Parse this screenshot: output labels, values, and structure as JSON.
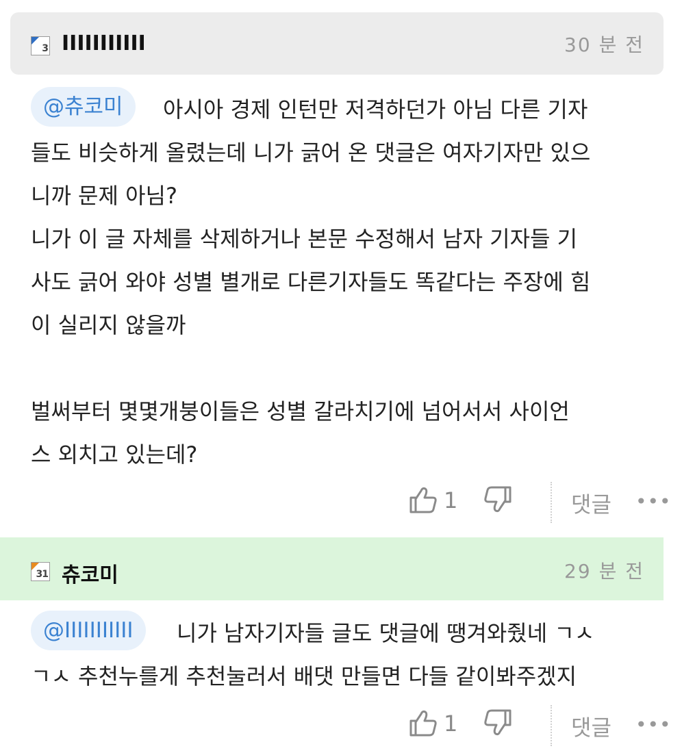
{
  "comments": [
    {
      "level": "3",
      "username": "IIIIIIIIIII",
      "time": "30 분 전",
      "mention": "@츄코미",
      "lines": [
        "아시아 경제 인턴만 저격하던가 아님 다른 기자",
        "들도 비슷하게 올렸는데 니가 긁어 온 댓글은 여자기자만 있으",
        "니까 문제 아님?",
        "니가 이 글 자체를 삭제하거나 본문 수정해서 남자 기자들 기",
        "사도 긁어 와야 성별 별개로 다른기자들도 똑같다는 주장에 힘",
        "이 실리지 않을까",
        "벌써부터 몇몇개붕이들은 성별 갈라치기에 넘어서서 사이언",
        "스 외치고 있는데?"
      ],
      "likes": "1",
      "reply_label": "댓글",
      "more_label": "•••"
    },
    {
      "level": "31",
      "username": "츄코미",
      "time": "29 분 전",
      "mention": "@IIIIIIIIIII",
      "lines": [
        "니가 남자기자들 글도 댓글에 땡겨와줬네 ㄱㅅ",
        "ㄱㅅ 추천누를게 추천눌러서 배댓 만들면 다들 같이봐주겠지"
      ],
      "likes": "1",
      "reply_label": "댓글",
      "more_label": "•••"
    }
  ],
  "colors": {
    "header_gray": "#ececec",
    "header_green": "#dcf5dc",
    "mention_text": "#3b82d1",
    "mention_bg": "#e8f1fb"
  }
}
